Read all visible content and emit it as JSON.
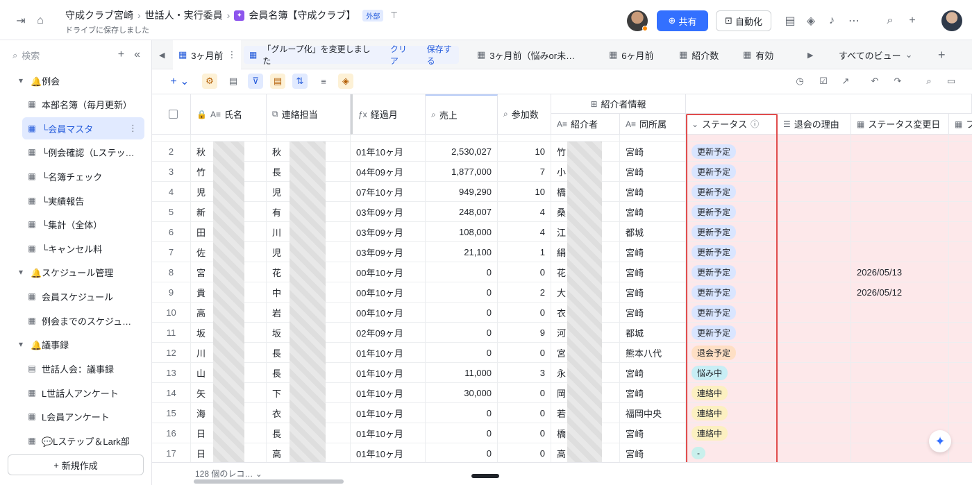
{
  "header": {
    "breadcrumb": [
      "守成クラブ宮崎",
      "世話人・実行委員",
      "会員名簿【守成クラブ】"
    ],
    "external_tag": "外部",
    "saved_text": "ドライブに保存しました",
    "share_label": "共有",
    "automation_label": "自動化"
  },
  "sidebar": {
    "search_placeholder": "検索",
    "items": [
      {
        "label": "🔔例会",
        "icon": "caret-down-icon"
      },
      {
        "label": "本部名簿（毎月更新）",
        "icon": "table-icon"
      },
      {
        "label": "└会員マスタ",
        "icon": "table-icon"
      },
      {
        "label": "└例会確認（Lステッ…",
        "icon": "table-icon"
      },
      {
        "label": "└名簿チェック",
        "icon": "table-icon"
      },
      {
        "label": "└実績報告",
        "icon": "table-icon"
      },
      {
        "label": "└集計（全体）",
        "icon": "table-icon"
      },
      {
        "label": "└キャンセル料",
        "icon": "table-icon"
      },
      {
        "label": "🔔スケジュール管理",
        "icon": "caret-down-icon"
      },
      {
        "label": "会員スケジュール",
        "icon": "table-icon"
      },
      {
        "label": "例会までのスケジュ…",
        "icon": "table-icon"
      },
      {
        "label": "🔔議事録",
        "icon": "caret-down-icon"
      },
      {
        "label": "世話人会：議事録",
        "icon": "doc-icon"
      },
      {
        "label": "L世話人アンケート",
        "icon": "table-icon"
      },
      {
        "label": "L会員アンケート",
        "icon": "table-icon"
      },
      {
        "label": "💬Lステップ＆Lark部",
        "icon": "table-icon"
      }
    ],
    "new_label": "新規作成"
  },
  "viewbar": {
    "current_view": "3ヶ月前",
    "notice": "「グループ化」を変更しました",
    "clear_label": "クリア",
    "save_label": "保存する",
    "tabs": [
      "3ヶ月前（悩みor未…",
      "6ヶ月前",
      "紹介数",
      "有効"
    ],
    "all_views": "すべてのビュー"
  },
  "grid": {
    "group_header": "紹介者情報",
    "headers": {
      "name": "氏名",
      "contact": "連絡担当",
      "months": "経過月",
      "sales": "売上",
      "attend": "参加数",
      "referrer": "紹介者",
      "affil": "同所属",
      "status": "ステータス",
      "reason": "退会の理由",
      "changed": "ステータス変更日",
      "extra": "フ"
    },
    "rows": [
      {
        "idx": "2",
        "name": "秋",
        "contact": "秋",
        "months": "01年10ヶ月",
        "sales": "2,530,027",
        "attend": "10",
        "referrer": "竹",
        "affil": "宮崎",
        "status": "更新予定",
        "tone": "blue",
        "date": ""
      },
      {
        "idx": "3",
        "name": "竹",
        "contact": "長",
        "months": "04年09ヶ月",
        "sales": "1,877,000",
        "attend": "7",
        "referrer": "小",
        "affil": "宮崎",
        "status": "更新予定",
        "tone": "blue",
        "date": ""
      },
      {
        "idx": "4",
        "name": "児",
        "contact": "児",
        "months": "07年10ヶ月",
        "sales": "949,290",
        "attend": "10",
        "referrer": "橋",
        "affil": "宮崎",
        "status": "更新予定",
        "tone": "blue",
        "date": ""
      },
      {
        "idx": "5",
        "name": "新",
        "contact": "有",
        "months": "03年09ヶ月",
        "sales": "248,007",
        "attend": "4",
        "referrer": "桑",
        "affil": "宮崎",
        "status": "更新予定",
        "tone": "blue",
        "date": ""
      },
      {
        "idx": "6",
        "name": "田",
        "contact": "川",
        "months": "03年09ヶ月",
        "sales": "108,000",
        "attend": "4",
        "referrer": "江",
        "affil": "都城",
        "status": "更新予定",
        "tone": "blue",
        "date": ""
      },
      {
        "idx": "7",
        "name": "佐",
        "contact": "児",
        "months": "03年09ヶ月",
        "sales": "21,100",
        "attend": "1",
        "referrer": "絹",
        "affil": "宮崎",
        "status": "更新予定",
        "tone": "blue",
        "date": ""
      },
      {
        "idx": "8",
        "name": "宮",
        "contact": "花",
        "months": "00年10ヶ月",
        "sales": "0",
        "attend": "0",
        "referrer": "花",
        "affil": "宮崎",
        "status": "更新予定",
        "tone": "blue",
        "date": "2026/05/13"
      },
      {
        "idx": "9",
        "name": "貴",
        "contact": "中",
        "months": "00年10ヶ月",
        "sales": "0",
        "attend": "2",
        "referrer": "大",
        "affil": "宮崎",
        "status": "更新予定",
        "tone": "blue",
        "date": "2026/05/12"
      },
      {
        "idx": "10",
        "name": "高",
        "contact": "岩",
        "months": "00年10ヶ月",
        "sales": "0",
        "attend": "0",
        "referrer": "衣",
        "affil": "宮崎",
        "status": "更新予定",
        "tone": "blue",
        "date": ""
      },
      {
        "idx": "11",
        "name": "坂",
        "contact": "坂",
        "months": "02年09ヶ月",
        "sales": "0",
        "attend": "9",
        "referrer": "河",
        "affil": "都城",
        "status": "更新予定",
        "tone": "blue",
        "date": ""
      },
      {
        "idx": "12",
        "name": "川",
        "contact": "長",
        "months": "01年10ヶ月",
        "sales": "0",
        "attend": "0",
        "referrer": "宮",
        "affil": "熊本八代",
        "status": "退会予定",
        "tone": "orange",
        "date": ""
      },
      {
        "idx": "13",
        "name": "山",
        "contact": "長",
        "months": "01年10ヶ月",
        "sales": "11,000",
        "attend": "3",
        "referrer": "永",
        "affil": "宮崎",
        "status": "悩み中",
        "tone": "cyan",
        "date": ""
      },
      {
        "idx": "14",
        "name": "矢",
        "contact": "下",
        "months": "01年10ヶ月",
        "sales": "30,000",
        "attend": "0",
        "referrer": "岡",
        "affil": "宮崎",
        "status": "連絡中",
        "tone": "yellow",
        "date": ""
      },
      {
        "idx": "15",
        "name": "海",
        "contact": "衣",
        "months": "01年10ヶ月",
        "sales": "0",
        "attend": "0",
        "referrer": "若",
        "affil": "福岡中央",
        "status": "連絡中",
        "tone": "yellow",
        "date": ""
      },
      {
        "idx": "16",
        "name": "日",
        "contact": "長",
        "months": "01年10ヶ月",
        "sales": "0",
        "attend": "0",
        "referrer": "橋",
        "affil": "宮崎",
        "status": "連絡中",
        "tone": "yellow",
        "date": ""
      },
      {
        "idx": "17",
        "name": "日",
        "contact": "高",
        "months": "01年10ヶ月",
        "sales": "0",
        "attend": "0",
        "referrer": "高",
        "affil": "宮崎",
        "status": "-",
        "tone": "teal",
        "date": ""
      }
    ]
  },
  "footer": {
    "records": "128 個のレコ…"
  },
  "colors": {
    "accent": "#3370ff",
    "status_highlight": "#e04d4d",
    "pink_column": "#fde8ea"
  }
}
